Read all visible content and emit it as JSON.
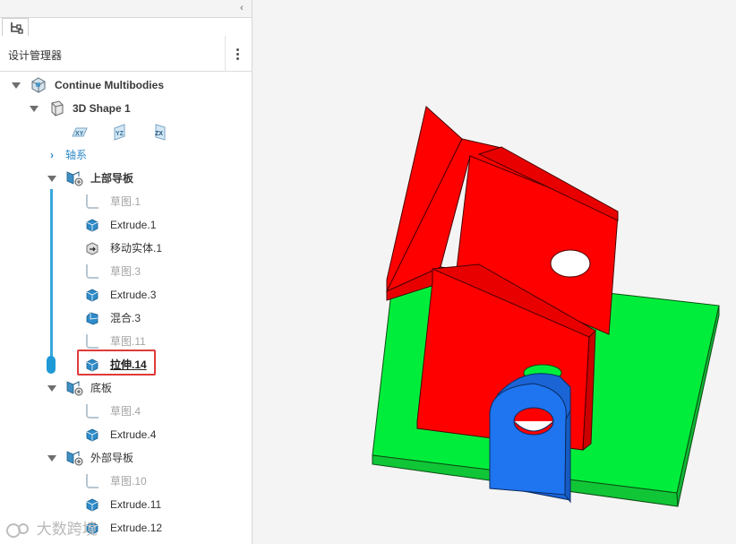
{
  "panel": {
    "title": "设计管理器"
  },
  "tree": {
    "root": "Continue Multibodies",
    "shape": "3D Shape 1",
    "planes": [
      "XY",
      "YZ",
      "ZX"
    ],
    "axis": "轴系",
    "upper_group": "上部导板",
    "upper_items": [
      "草图.1",
      "Extrude.1",
      "移动实体.1",
      "草图.3",
      "Extrude.3",
      "混合.3",
      "草图.11",
      "拉伸.14"
    ],
    "base_group": "底板",
    "base_items": [
      "草图.4",
      "Extrude.4"
    ],
    "outer_group": "外部导板",
    "outer_items": [
      "草图.10",
      "Extrude.11",
      "Extrude.12"
    ]
  },
  "watermark": "大数跨境",
  "colors": {
    "accent": "#2f8bc9",
    "highlight": "#e03a3a",
    "red_body": "#ff0000",
    "green_body": "#00ee3b",
    "blue_body": "#1a64d6"
  }
}
